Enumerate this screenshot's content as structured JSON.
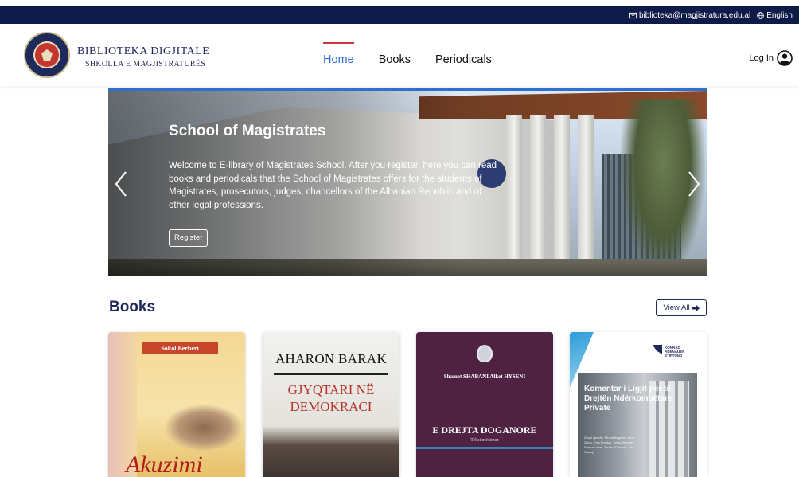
{
  "topbar": {
    "email": "biblioteka@magjistratura.edu.al",
    "language": "English",
    "icons": [
      "mail-icon",
      "globe-icon"
    ]
  },
  "header": {
    "brand_title": "BIBLIOTEKA DIGJITALE",
    "brand_subtitle": "SHKOLLA E MAGJISTRATURËS",
    "nav": [
      {
        "label": "Home",
        "active": true
      },
      {
        "label": "Books",
        "active": false
      },
      {
        "label": "Periodicals",
        "active": false
      }
    ],
    "login_label": "Log In"
  },
  "hero": {
    "title": "School of Magistrates",
    "text": "Welcome to E-library of Magistrates School. After you register, here you can read books and periodicals that the School of Magistrates offers for the students of Magistrates, prosecutors, judges, chancellors of the Albanian Republic and of other legal professions.",
    "button_label": "Register"
  },
  "books_section": {
    "title": "Books",
    "view_all_label": "View All"
  },
  "books": [
    {
      "author": "Sokol Berberi",
      "title_script": "Akuzimi"
    },
    {
      "author": "AHARON BARAK",
      "title_line1": "GJYQTARI NË",
      "title_line2": "DEMOKRACI"
    },
    {
      "authors": "Shamet SHABANI      Alket HYSENI",
      "title": "E DREJTA DOGANORE",
      "subtitle": "- Tekst mësimor -"
    },
    {
      "publisher": "KONRAD ADENAUER STIFTUNG",
      "title": "Komentar i Ligjit për të Drejtën Ndërkombëtare Private",
      "contributors": "Grupi i punës: Mirela Bogdani, Aida Gugu, Evis Bombaj, Erlisa Dervishi, Ermira Lame, Taulant Dervishi, Ilda Stanaj"
    }
  ],
  "colors": {
    "topbar": "#0e1a48",
    "brand": "#1f2a5c",
    "nav_active": "#2e6fd1",
    "nav_indicator": "#d13a3a"
  }
}
